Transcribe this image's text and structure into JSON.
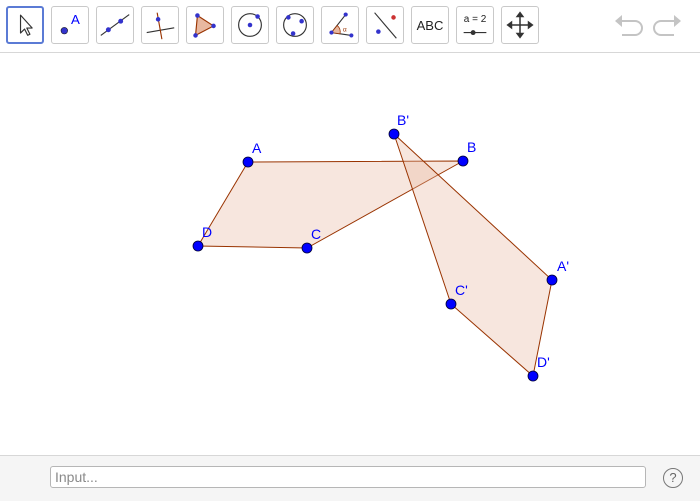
{
  "toolbar": {
    "tools": [
      {
        "name": "move-tool",
        "icon": "cursor-arrow-icon"
      },
      {
        "name": "point-tool",
        "icon": "point-icon",
        "label": "A"
      },
      {
        "name": "line-tool",
        "icon": "line-through-points-icon"
      },
      {
        "name": "perpendicular-line-tool",
        "icon": "perpendicular-line-icon"
      },
      {
        "name": "polygon-tool",
        "icon": "polygon-icon"
      },
      {
        "name": "circle-center-point-tool",
        "icon": "circle-center-point-icon"
      },
      {
        "name": "circle-three-points-tool",
        "icon": "circle-three-points-icon"
      },
      {
        "name": "angle-tool",
        "icon": "angle-icon"
      },
      {
        "name": "reflect-about-line-tool",
        "icon": "reflect-line-icon"
      },
      {
        "name": "text-tool",
        "icon": "text-icon",
        "label": "ABC"
      },
      {
        "name": "slider-tool",
        "icon": "slider-icon",
        "label": "a = 2"
      },
      {
        "name": "move-graphics-view-tool",
        "icon": "move-arrows-icon"
      }
    ],
    "selected": "move-tool"
  },
  "colors": {
    "point": "#0000ff",
    "polygon_stroke": "#993300",
    "polygon_fill": "#e8b8a0",
    "selected_border": "#5b7bd5"
  },
  "graphics": {
    "points": [
      {
        "label": "A"
      },
      {
        "label": "B"
      },
      {
        "label": "C"
      },
      {
        "label": "D"
      },
      {
        "label": "B'"
      },
      {
        "label": "A'"
      },
      {
        "label": "C'"
      },
      {
        "label": "D'"
      }
    ],
    "polygons": [
      {
        "vertices": [
          "A",
          "B",
          "C",
          "D"
        ]
      },
      {
        "vertices": [
          "B'",
          "A'",
          "D'",
          "C'"
        ]
      }
    ]
  },
  "input_bar": {
    "placeholder": "Input..."
  },
  "help": {
    "label": "?"
  }
}
